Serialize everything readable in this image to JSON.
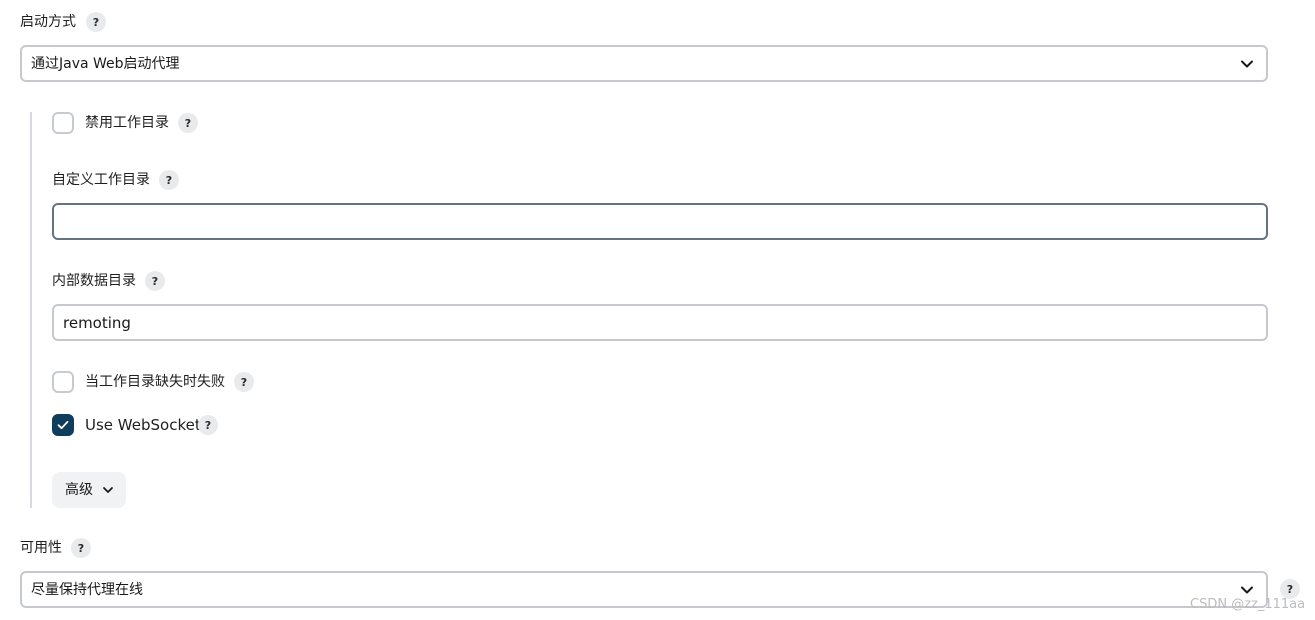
{
  "launch_method": {
    "label": "启动方式",
    "help": "?",
    "value": "通过Java Web启动代理"
  },
  "disable_workdir": {
    "label": "禁用工作目录",
    "help": "?",
    "checked": false
  },
  "custom_workdir": {
    "label": "自定义工作目录",
    "help": "?",
    "value": ""
  },
  "internal_data_dir": {
    "label": "内部数据目录",
    "help": "?",
    "value": "remoting"
  },
  "fail_if_missing": {
    "label": "当工作目录缺失时失败",
    "help": "?",
    "checked": false
  },
  "use_websocket": {
    "label": "Use WebSocket",
    "help": "?",
    "checked": true
  },
  "advanced": {
    "label": "高级"
  },
  "availability": {
    "label": "可用性",
    "help": "?",
    "value": "尽量保持代理在线",
    "side_help": "?"
  },
  "watermark": "CSDN @zz_111aa",
  "colors": {
    "checkbox_checked": "#0f3d5c",
    "focus_border": "#66747f",
    "border": "#c5c9cd",
    "help_bg": "#e9eaec"
  }
}
